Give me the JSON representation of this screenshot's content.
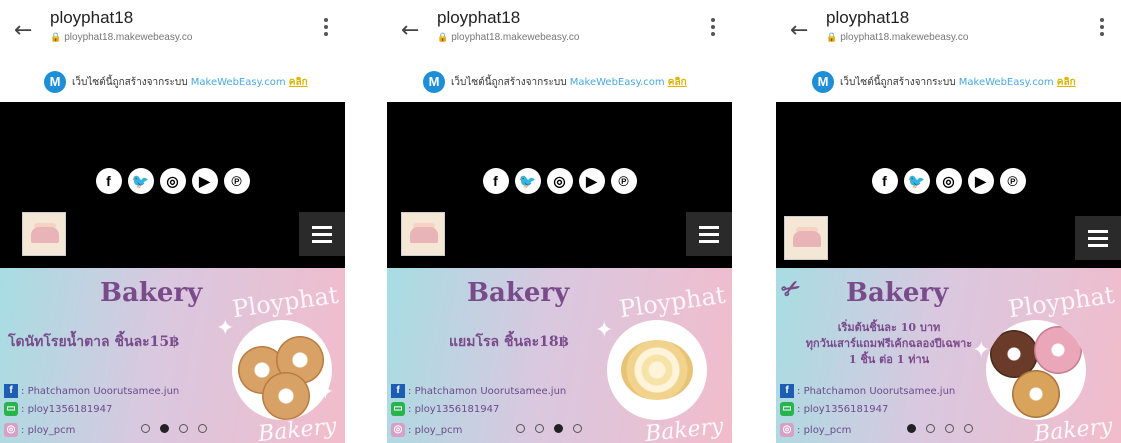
{
  "phones": [
    {
      "header": {
        "title": "ployphat18",
        "url": "ployphat18.makewebeasy.co"
      },
      "notice": {
        "logo": "M",
        "text": "เว็บไซต์นี้ถูกสร้างจากระบบ",
        "link": "MakeWebEasy.com",
        "click": "คลิก"
      },
      "banner": {
        "title": "Bakery",
        "promo": [
          "โดนัทโรยน้ำตาล ชิ้นละ15฿"
        ],
        "watermark_top": "Ployphat",
        "watermark_bottom": "Bakery",
        "active_slide": 1
      },
      "contacts": [
        "Phatchamon Uoorutsamee.jun",
        "ploy1356181947",
        "ploy_pcm"
      ]
    },
    {
      "header": {
        "title": "ployphat18",
        "url": "ployphat18.makewebeasy.co"
      },
      "notice": {
        "logo": "M",
        "text": "เว็บไซต์นี้ถูกสร้างจากระบบ",
        "link": "MakeWebEasy.com",
        "click": "คลิก"
      },
      "banner": {
        "title": "Bakery",
        "promo": [
          "แยมโรล ชิ้นละ18฿"
        ],
        "watermark_top": "Ployphat",
        "watermark_bottom": "Bakery",
        "active_slide": 2
      },
      "contacts": [
        "Phatchamon Uoorutsamee.jun",
        "ploy1356181947",
        "ploy_pcm"
      ]
    },
    {
      "header": {
        "title": "ployphat18",
        "url": "ployphat18.makewebeasy.co"
      },
      "notice": {
        "logo": "M",
        "text": "เว็บไซต์นี้ถูกสร้างจากระบบ",
        "link": "MakeWebEasy.com",
        "click": "คลิก"
      },
      "banner": {
        "title": "Bakery",
        "promo": [
          "เริ่มต้นชิ้นละ 10 บาท",
          "ทุกวันเสาร์แถมฟรีเค้กฉลองปีเฉพาะ",
          "1 ชิ้น ต่อ 1 ท่าน"
        ],
        "watermark_top": "Ployphat",
        "watermark_bottom": "Bakery",
        "active_slide": 0
      },
      "contacts": [
        "Phatchamon Uoorutsamee.jun",
        "ploy1356181947",
        "ploy_pcm"
      ]
    }
  ],
  "icons": {
    "back": "arrow-left-icon",
    "menu": "more-vertical-icon",
    "lock": "lock-icon",
    "socials": [
      "facebook-icon",
      "twitter-icon",
      "instagram-icon",
      "youtube-icon",
      "pinterest-icon"
    ],
    "hamburger": "hamburger-menu-icon",
    "contact_icons": [
      "facebook-icon",
      "line-icon",
      "instagram-icon"
    ]
  },
  "social_glyphs": [
    "f",
    "🐦",
    "◎",
    "▶",
    "℗"
  ],
  "contact_glyphs": [
    "f",
    "▭",
    "◎"
  ],
  "colors": {
    "brand_purple": "#7a4b8a",
    "makewebeasy_blue": "#1e8fd6",
    "click_gold": "#d8b400",
    "hero_black": "#000000"
  }
}
